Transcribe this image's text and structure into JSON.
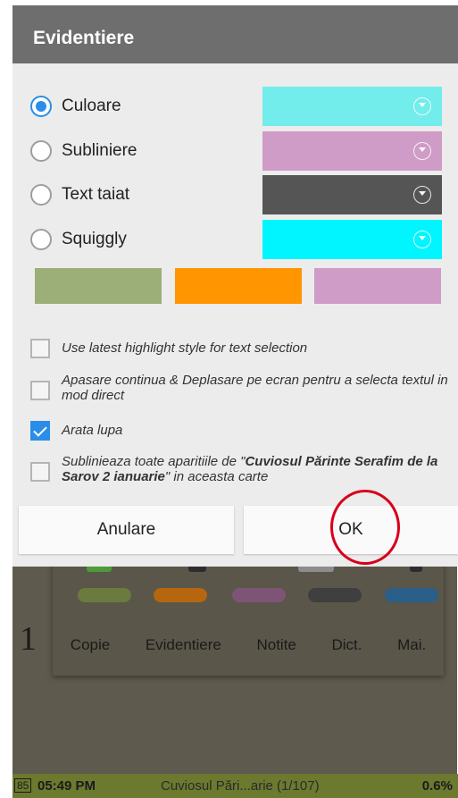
{
  "dialog": {
    "title": "Evidentiere",
    "options": [
      {
        "label": "Culoare",
        "selected": true,
        "color": "#73ecec"
      },
      {
        "label": "Subliniere",
        "selected": false,
        "color": "#cf9bc7"
      },
      {
        "label": "Text taiat",
        "selected": false,
        "color": "#555555"
      },
      {
        "label": "Squiggly",
        "selected": false,
        "color": "#00f5ff"
      }
    ],
    "presets": [
      "#9caf78",
      "#ff9500",
      "#cf9bc7"
    ],
    "checkboxes": [
      {
        "label": "Use latest highlight style for text selection",
        "checked": false
      },
      {
        "label": "Apasare continua & Deplasare pe ecran pentru a selecta textul in mod direct",
        "checked": false
      },
      {
        "label": "Arata lupa",
        "checked": true
      },
      {
        "label_pre": "Sublinieaza toate aparitiile de \"",
        "label_bold": "Cuviosul Părinte Serafim de la Sarov 2 ianuarie",
        "label_post": "\" in aceasta carte",
        "checked": false
      }
    ],
    "cancel_label": "Anulare",
    "ok_label": "OK"
  },
  "background": {
    "menu": [
      "Copie",
      "Evidentiere",
      "Notite",
      "Dict.",
      "Mai."
    ],
    "big_text": "1"
  },
  "statusbar": {
    "battery": "85",
    "time": "05:49 PM",
    "book": "Cuviosul Pări...arie (1/107)",
    "percent": "0.6%"
  },
  "colors": {
    "accent": "#2a8ee8",
    "header": "#6e6e6e",
    "annotation": "#d8001a"
  }
}
